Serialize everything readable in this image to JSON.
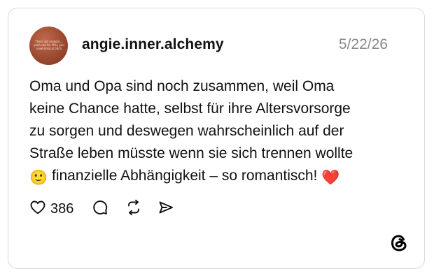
{
  "post": {
    "author": {
      "username": "angie.inner.alchemy",
      "avatar_text": "Thats not realistic... yeah not for YOU, you unwhimsical bitch"
    },
    "date": "5/22/26",
    "text_lines": [
      "Oma und Opa sind noch zusammen, weil Oma",
      "keine Chance hatte, selbst für ihre Altersvorsorge",
      "zu sorgen und deswegen wahrscheinlich auf der",
      "Straße leben müsste wenn sie sich trennen wollte",
      "finanzielle Abhängigkeit – so romantisch!"
    ],
    "emoji_smile": "🙂",
    "emoji_heart": "❤️",
    "likes": "386"
  },
  "icons": {
    "like": "heart-icon",
    "reply": "comment-icon",
    "repost": "repost-icon",
    "share": "send-icon",
    "brand": "threads-logo-icon"
  },
  "colors": {
    "text": "#111111",
    "muted": "#8a8a8a",
    "border": "#d9d9d9",
    "heart": "#e0245e"
  }
}
